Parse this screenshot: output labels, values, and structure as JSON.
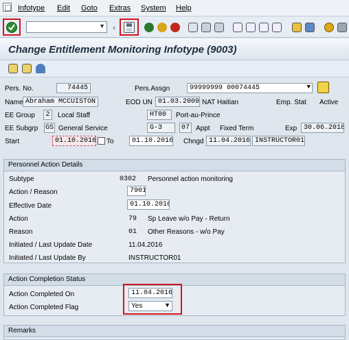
{
  "menu": {
    "items": [
      "Infotype",
      "Edit",
      "Goto",
      "Extras",
      "System",
      "Help"
    ]
  },
  "toolbar": {
    "command_value": "",
    "icons": [
      "enter-icon",
      "save-icon",
      "back-icon",
      "exit-icon",
      "cancel-icon",
      "print-icon",
      "find-icon",
      "find-next-icon",
      "first-page-icon",
      "previous-page-icon",
      "next-page-icon",
      "last-page-icon",
      "create-session-icon",
      "shortcut-icon",
      "help-icon",
      "customize-layout-icon"
    ]
  },
  "title": "Change Entitlement Monitoring Infotype (9003)",
  "header": {
    "pers_no_label": "Pers. No.",
    "pers_no": "74445",
    "pers_assgn_label": "Pers.Assgn",
    "pers_assgn": "99999999 00074445",
    "name_label": "Name",
    "name": "Abraham MCCUISTON",
    "eod_label": "EOD UN",
    "eod": "01.03.2009",
    "nat_label": "NAT",
    "nat": "Haitian",
    "emp_stat_label": "Emp. Stat",
    "emp_stat": "Active",
    "ee_group_label": "EE Group",
    "ee_group_code": "2",
    "ee_group": "Local Staff",
    "location_code": "HT00",
    "location": "Port-au-Prince",
    "ee_subgrp_label": "EE Subgrp",
    "ee_subgrp_code": "GS",
    "ee_subgrp": "General Service",
    "grade": "G-3",
    "step": "07",
    "appt_label": "Appt",
    "appt": "Fixed Term",
    "exp_label": "Exp",
    "exp": "30.06.2018",
    "start_label": "Start",
    "start": "01.10.2016",
    "to_label": "To",
    "to": "01.10.2016",
    "chngd_label": "Chngd",
    "chngd_date": "11.04.2016",
    "chngd_by": "INSTRUCTOR01"
  },
  "personnel_action": {
    "title": "Personnel Action Details",
    "rows": [
      {
        "label": "Subtype",
        "code": "0302",
        "value": "Personnel action monitoring"
      },
      {
        "label": "Action / Reason",
        "code": "7901",
        "value": ""
      },
      {
        "label": "Effective Date",
        "code": "01.10.2016",
        "value": ""
      },
      {
        "label": "Action",
        "code": "79",
        "value": "Sp Leave w/o Pay - Return"
      },
      {
        "label": "Reason",
        "code": "01",
        "value": "Other Reasons - w/o Pay"
      },
      {
        "label": "Initiated / Last Update Date",
        "code": "11.04.2016",
        "value": ""
      },
      {
        "label": "Initiated / Last Update By",
        "code": "INSTRUCTOR01",
        "value": ""
      }
    ]
  },
  "completion": {
    "title": "Action Completion Status",
    "completed_on_label": "Action Completed On",
    "completed_on": "11.04.2016",
    "completed_flag_label": "Action Completed Flag",
    "completed_flag": "Yes"
  },
  "remarks": {
    "title": "Remarks"
  },
  "colors": {
    "highlight": "#d0141e",
    "enter_green": "#2e8b2e"
  }
}
